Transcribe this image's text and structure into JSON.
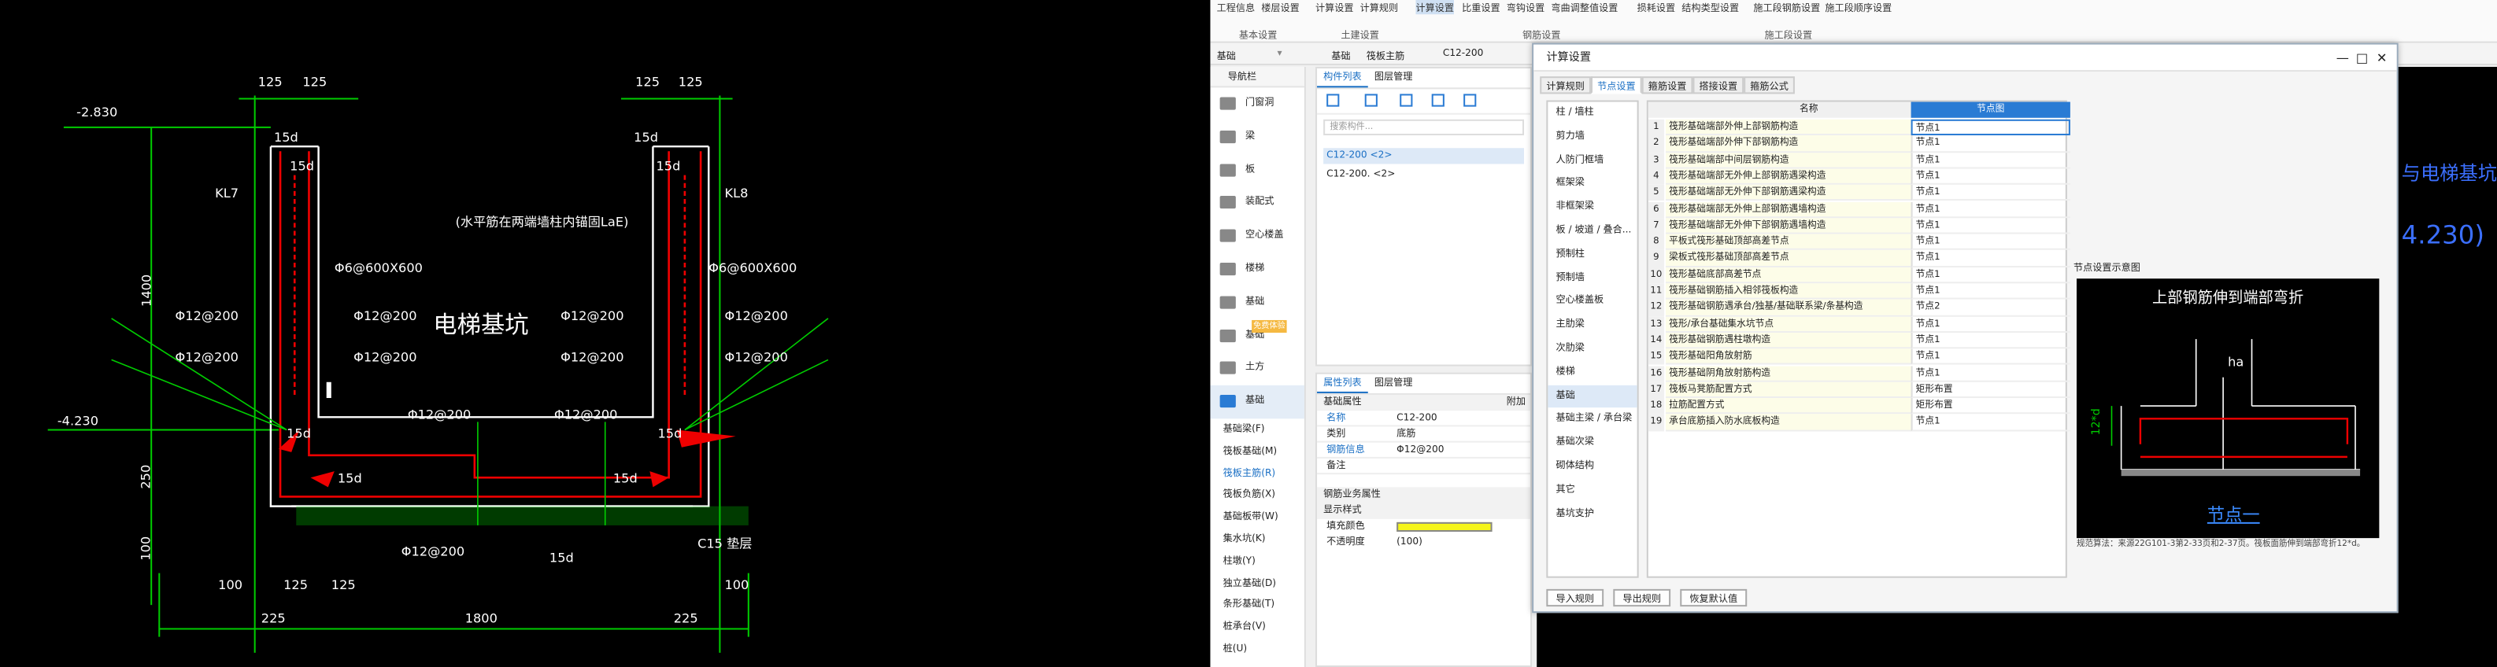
{
  "cad_left": {
    "dims_top": [
      "125",
      "125",
      "125",
      "125"
    ],
    "elev_top": "-2.830",
    "elev_mid": "-4.230",
    "kl7": "KL7",
    "kl8": "KL8",
    "note": "(水平筋在两端墙柱内锚固LaE)",
    "title": "电梯基坑",
    "stir_l": "Φ6@600X600",
    "stir_r": "Φ6@600X600",
    "bars": [
      "Φ12@200",
      "Φ12@200",
      "Φ12@200",
      "Φ12@200",
      "Φ12@200",
      "Φ12@200",
      "Φ12@200",
      "Φ12@200",
      "Φ12@200",
      "Φ12@200",
      "Φ12@200"
    ],
    "lap": [
      "15d",
      "15d",
      "15d",
      "15d",
      "15d",
      "15d",
      "15d",
      "15d"
    ],
    "dim_1400": "1400",
    "dim_250": "250",
    "dim_100": "100",
    "bottom_dims": [
      "100",
      "125",
      "125",
      "100",
      "225",
      "1800",
      "225"
    ],
    "cushion": "C15 垫层",
    "lap_d": "15d"
  },
  "ribbon": {
    "tabs": [
      "工程信息",
      "楼层设置",
      "计算设置",
      "计算规则",
      "计算设置",
      "比重设置",
      "弯钩设置",
      "弯曲调整值设置",
      "损耗设置",
      "结构类型设置",
      "施工段钢筋设置",
      "施工段顺序设置"
    ],
    "groups": [
      "基本设置",
      "土建设置",
      "钢筋设置",
      "施工段设置"
    ]
  },
  "toolbar": {
    "items": [
      "基础",
      "基础",
      "筏板主筋",
      "C12-200"
    ]
  },
  "nav": {
    "title": "导航栏",
    "items": [
      "门窗洞",
      "梁",
      "板",
      "装配式",
      "空心楼盖",
      "楼梯",
      "基础",
      "基础",
      "土方",
      "基础"
    ],
    "subs": [
      "基础梁(F)",
      "筏板基础(M)",
      "筏板主筋(R)",
      "筏板负筋(X)",
      "基础板带(W)",
      "集水坑(K)",
      "柱墩(Y)",
      "独立基础(D)",
      "条形基础(T)",
      "桩承台(V)",
      "桩(U)"
    ],
    "tooltip": "免费体验"
  },
  "comp": {
    "tabs": [
      "构件列表",
      "图层管理"
    ],
    "search": "搜索构件...",
    "items": [
      "C12-200 <2>",
      "C12-200. <2>"
    ]
  },
  "prop": {
    "tabs": [
      "属性列表",
      "图层管理"
    ],
    "section": "基础属性",
    "rows": [
      [
        "名称",
        "C12-200"
      ],
      [
        "类别",
        "底筋"
      ],
      [
        "钢筋信息",
        "Φ12@200"
      ],
      [
        "备注",
        ""
      ]
    ],
    "sec2": "钢筋业务属性",
    "sec3": "显示样式",
    "rows2": [
      [
        "填充颜色",
        ""
      ],
      [
        "不透明度",
        "(100)"
      ]
    ],
    "attach": "附加",
    "fill": "#f5f51a"
  },
  "dialog": {
    "title": "计算设置",
    "tabs": [
      "计算规则",
      "节点设置",
      "箍筋设置",
      "搭接设置",
      "箍筋公式"
    ],
    "cats": [
      "柱 / 墙柱",
      "剪力墙",
      "人防门框墙",
      "框架梁",
      "非框架梁",
      "板 / 坡道 / 叠合...",
      "预制柱",
      "预制墙",
      "空心楼盖板",
      "主肋梁",
      "次肋梁",
      "楼梯",
      "基础",
      "基础主梁 / 承台梁",
      "基础次梁",
      "砌体结构",
      "其它",
      "基坑支护"
    ],
    "col_name": "名称",
    "col_node": "节点图",
    "rows": [
      [
        "1",
        "筏形基础端部外伸上部钢筋构造",
        "节点1"
      ],
      [
        "2",
        "筏形基础端部外伸下部钢筋构造",
        "节点1"
      ],
      [
        "3",
        "筏形基础端部中间层钢筋构造",
        "节点1"
      ],
      [
        "4",
        "筏形基础端部无外伸上部钢筋遇梁构造",
        "节点1"
      ],
      [
        "5",
        "筏形基础端部无外伸下部钢筋遇梁构造",
        "节点1"
      ],
      [
        "6",
        "筏形基础端部无外伸上部钢筋遇墙构造",
        "节点1"
      ],
      [
        "7",
        "筏形基础端部无外伸下部钢筋遇墙构造",
        "节点1"
      ],
      [
        "8",
        "平板式筏形基础顶部高差节点",
        "节点1"
      ],
      [
        "9",
        "梁板式筏形基础顶部高差节点",
        "节点1"
      ],
      [
        "10",
        "筏形基础底部高差节点",
        "节点1"
      ],
      [
        "11",
        "筏形基础钢筋插入相邻筏板构造",
        "节点1"
      ],
      [
        "12",
        "筏形基础钢筋遇承台/独基/基础联系梁/条基构造",
        "节点2"
      ],
      [
        "13",
        "筏形/承台基础集水坑节点",
        "节点1"
      ],
      [
        "14",
        "筏形基础钢筋遇柱墩构造",
        "节点1"
      ],
      [
        "15",
        "筏形基础阳角放射筋",
        "节点1"
      ],
      [
        "16",
        "筏形基础阴角放射筋构造",
        "节点1"
      ],
      [
        "17",
        "筏板马凳筋配置方式",
        "矩形布置"
      ],
      [
        "18",
        "拉筋配置方式",
        "矩形布置"
      ],
      [
        "19",
        "承台底筋插入防水底板构造",
        "节点1"
      ]
    ],
    "preview_label": "节点设置示意图",
    "preview_title": "上部钢筋伸到端部弯折",
    "preview_ha": "ha",
    "preview_12d": "12*d",
    "preview_node": "节点一",
    "preview_note": "规范算法：来源22G101-3第2-33页和2-37页。筏板面筋伸到端部弯折12*d。",
    "buttons": [
      "导入规则",
      "导出规则",
      "恢复默认值"
    ]
  },
  "cad_right": {
    "text1": "与电梯基坑",
    "text2": "4.230)"
  }
}
